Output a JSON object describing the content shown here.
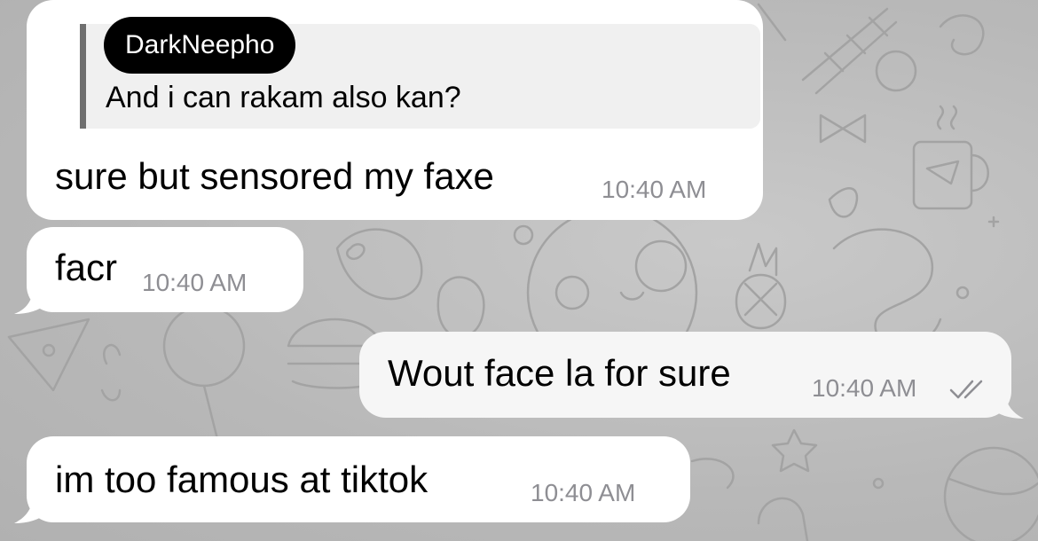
{
  "messages": [
    {
      "reply": {
        "name": "DarkNeepho",
        "text": "And i can rakam also kan?"
      },
      "text": "sure but sensored my faxe",
      "time": "10:40 AM"
    },
    {
      "text": "facr",
      "time": "10:40 AM"
    },
    {
      "text": "Wout face la for sure",
      "time": "10:40 AM",
      "status": "double-check-icon"
    },
    {
      "text": "im too famous at tiktok",
      "time": "10:40 AM"
    }
  ],
  "colors": {
    "background": "#bdbdbd",
    "incoming_bubble": "#ffffff",
    "outgoing_bubble": "#f6f6f6",
    "reply_bar": "#6f6f6f",
    "timestamp": "#8e8e93"
  }
}
